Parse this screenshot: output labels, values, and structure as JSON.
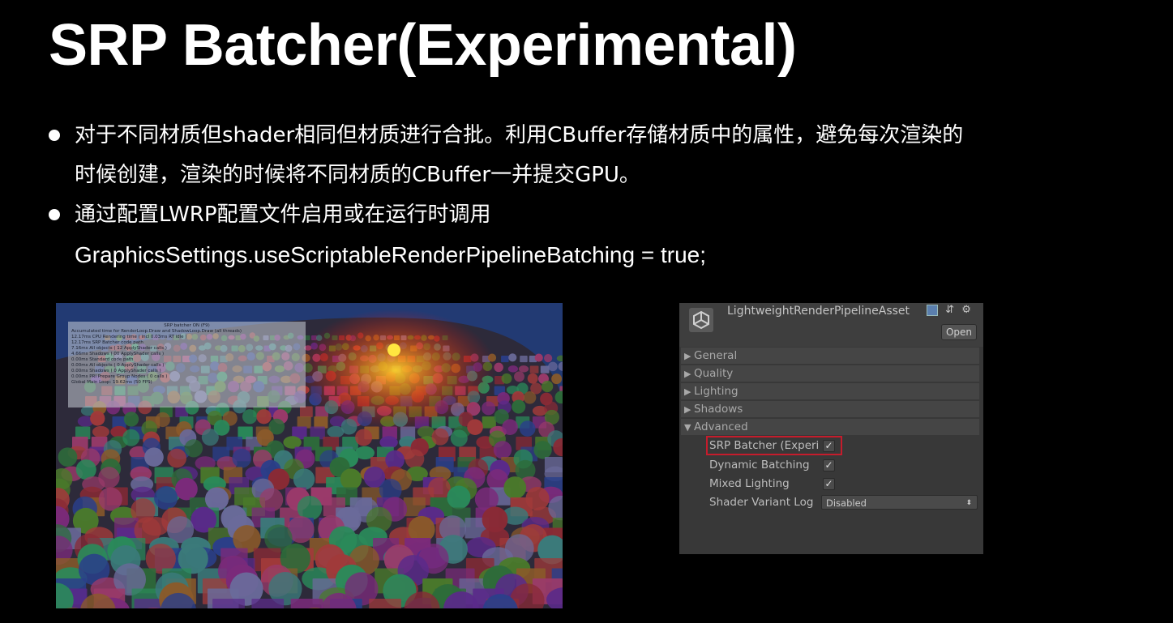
{
  "slide": {
    "title": "SRP Batcher(Experimental)",
    "bullets": [
      {
        "lines": [
          "对于不同材质但shader相同但材质进行合批。利用CBuffer存储材质中的属性，避免每次渲染的",
          "时候创建，渲染的时候将不同材质的CBuffer一并提交GPU。"
        ]
      },
      {
        "lines": [
          "通过配置LWRP配置文件启用或在运行时调用",
          "GraphicsSettings.useScriptableRenderPipelineBatching = true;"
        ]
      }
    ]
  },
  "scene": {
    "stats": {
      "title": "SRP batcher ON (F9)",
      "lines": [
        "Accumulated time for RenderLoop.Draw and ShadowLoop.Draw (all threads)",
        "12.17ms CPU Rendering time ( incl 0.03ms RT idle )",
        "12.17ms SRP Batcher code path",
        "7.16ms All objects ( 12 ApplyShader calls )",
        "4.66ms Shadows ( 00 ApplyShader calls )",
        "0.00ms Standard code path",
        "0.00ms All objects ( 0 ApplyShader calls )",
        "0.00ms Shadows ( 0 ApplyShader calls )",
        "0.00ms PRI Prepare Group Nodes ( 0 calls )",
        "Global Main Loop: 19.62ms (50 FPS)"
      ]
    }
  },
  "inspector": {
    "asset_name": "LightweightRenderPipelineAsset",
    "open_label": "Open",
    "icons": [
      "unity-logo-icon",
      "help-book-icon",
      "preset-icon",
      "gear-icon"
    ],
    "sections": [
      {
        "label": "General",
        "expanded": false
      },
      {
        "label": "Quality",
        "expanded": false
      },
      {
        "label": "Lighting",
        "expanded": false
      },
      {
        "label": "Shadows",
        "expanded": false
      },
      {
        "label": "Advanced",
        "expanded": true
      }
    ],
    "advanced": {
      "srp_batcher_label": "SRP Batcher (Experi",
      "srp_batcher_checked": true,
      "dynamic_batching_label": "Dynamic Batching",
      "dynamic_batching_checked": true,
      "mixed_lighting_label": "Mixed Lighting",
      "mixed_lighting_checked": true,
      "shader_variant_log_label": "Shader Variant Log",
      "shader_variant_log_value": "Disabled"
    },
    "highlight_color": "#c51c2c"
  }
}
